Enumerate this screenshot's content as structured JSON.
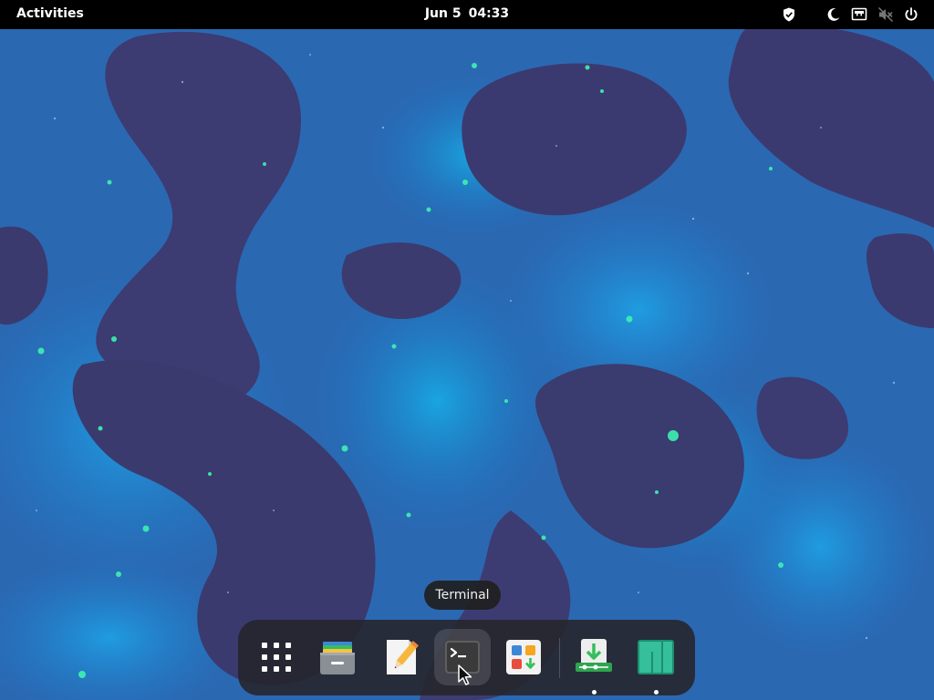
{
  "topbar": {
    "activities_label": "Activities",
    "date": "Jun 5",
    "time": "04:33",
    "tray": {
      "icons": [
        "shield-icon",
        "night-light-icon",
        "network-wired-icon",
        "audio-muted-icon",
        "power-icon"
      ]
    }
  },
  "tooltip": {
    "text": "Terminal"
  },
  "dock": {
    "items": [
      {
        "app": "Show Apps",
        "icon": "app-grid-icon",
        "running": false
      },
      {
        "app": "Files",
        "icon": "file-cabinet-icon",
        "running": false
      },
      {
        "app": "Text Editor",
        "icon": "text-editor-icon",
        "running": false
      },
      {
        "app": "Terminal",
        "icon": "terminal-icon",
        "running": false,
        "hovered": true
      },
      {
        "app": "Software",
        "icon": "software-store-icon",
        "running": false
      },
      {
        "app": "Software Updater",
        "icon": "software-updater-icon",
        "running": true
      },
      {
        "app": "Manjaro Settings",
        "icon": "manjaro-logo-icon",
        "running": true
      }
    ]
  },
  "colors": {
    "topbar_bg": "#000000",
    "dock_bg": "#26262c",
    "accent_green": "#35bf5c",
    "manjaro_teal": "#16a085"
  }
}
